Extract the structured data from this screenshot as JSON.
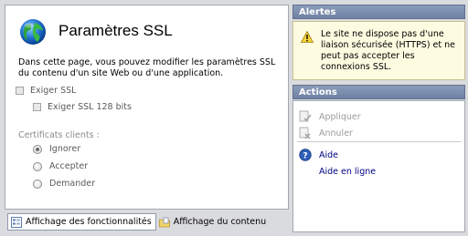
{
  "main": {
    "title": "Paramètres SSL",
    "description": "Dans cette page, vous pouvez modifier les paramètres SSL du contenu d'un site Web ou d'une application.",
    "require_ssl": {
      "label": "Exiger SSL",
      "checked": false
    },
    "require_ssl_128": {
      "label": "Exiger SSL 128 bits",
      "checked": false
    },
    "client_certs": {
      "label": "Certificats clients :",
      "options": [
        {
          "label": "Ignorer",
          "checked": true
        },
        {
          "label": "Accepter",
          "checked": false
        },
        {
          "label": "Demander",
          "checked": false
        }
      ]
    }
  },
  "tabs": [
    {
      "label": "Affichage des fonctionnalités",
      "active": true
    },
    {
      "label": "Affichage du contenu",
      "active": false
    }
  ],
  "alerts": {
    "header": "Alertes",
    "message": "Le site ne dispose pas d'une liaison sécurisée (HTTPS) et ne peut pas accepter les connexions SSL."
  },
  "actions": {
    "header": "Actions",
    "apply": "Appliquer",
    "cancel": "Annuler",
    "help": "Aide",
    "online_help": "Aide en ligne"
  },
  "colors": {
    "panel_header": "#7f90b0",
    "alert_background": "#fdfbe0",
    "link": "#000080"
  }
}
